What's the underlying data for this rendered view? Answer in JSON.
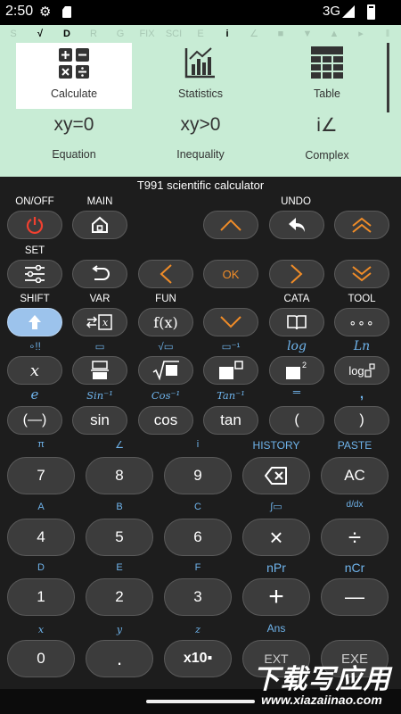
{
  "status": {
    "time": "2:50",
    "network": "3G"
  },
  "indicators": [
    "S",
    "√",
    "D",
    "R",
    "G",
    "FIX",
    "SCI",
    "E",
    "i",
    "∠",
    "■",
    "▼",
    "▲",
    "▸",
    "‖"
  ],
  "modes": {
    "calculate": "Calculate",
    "statistics": "Statistics",
    "table": "Table",
    "equation_big": "xy=0",
    "equation": "Equation",
    "inequality_big": "xy>0",
    "inequality": "Inequality",
    "complex_big": "i∠",
    "complex": "Complex"
  },
  "title": "T991 scientific calculator",
  "top_labels": {
    "on_off": "ON/OFF",
    "main": "MAIN",
    "undo": "UNDO",
    "set": "SET",
    "shift": "SHIFT",
    "var": "VAR",
    "fun": "FUN",
    "cata": "CATA",
    "tool": "TOOL"
  },
  "keys": {
    "ok": "OK",
    "fx": "f(x)",
    "tool": "∘∘∘",
    "x": "x",
    "neg": "(—)",
    "sin": "sin",
    "cos": "cos",
    "tan": "tan",
    "lparen": "(",
    "rparen": ")",
    "var": "⇄ x",
    "log_sub": "log",
    "sq": "2"
  },
  "shift_labels": {
    "row4": [
      "∘!!",
      "▭",
      "√▭",
      "▭⁻¹",
      "log",
      "Ln"
    ],
    "row5": [
      "e",
      "Sin⁻¹",
      "Cos⁻¹",
      "Tan⁻¹",
      "═",
      ","
    ]
  },
  "numpad": {
    "row1": {
      "labels": [
        "π",
        "∠",
        "i",
        "HISTORY",
        "PASTE"
      ],
      "keys": [
        "7",
        "8",
        "9",
        "⌫",
        "AC"
      ]
    },
    "row2": {
      "labels": [
        "A",
        "B",
        "C",
        "∫▭",
        "d/dx"
      ],
      "keys": [
        "4",
        "5",
        "6",
        "×",
        "÷"
      ]
    },
    "row3": {
      "labels": [
        "D",
        "E",
        "F",
        "nPr",
        "nCr"
      ],
      "keys": [
        "1",
        "2",
        "3",
        "+",
        "—"
      ]
    },
    "row4": {
      "labels": [
        "x",
        "y",
        "z",
        "Ans",
        ""
      ],
      "keys": [
        "0",
        ".",
        "x10▪",
        "EXT",
        "EXE"
      ]
    }
  },
  "watermark": {
    "line1": "下载写应用",
    "line2": "www.xiazaiinao.com"
  }
}
